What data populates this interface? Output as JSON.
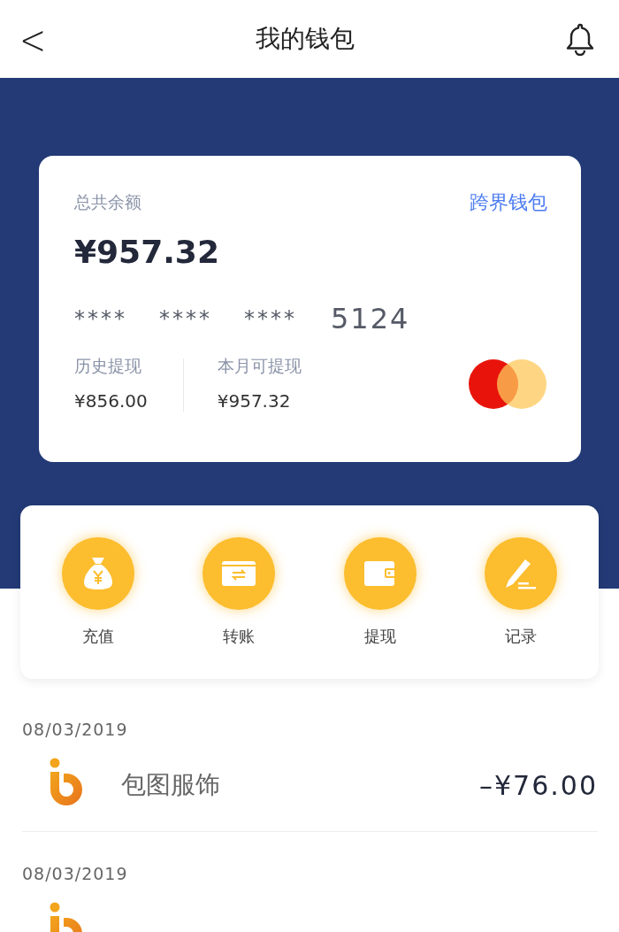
{
  "header": {
    "back": "<",
    "title": "我的钱包"
  },
  "card": {
    "balance_label": "总共余额",
    "link": "跨界钱包",
    "balance": "¥957.32",
    "masked": [
      "****",
      "****",
      "****"
    ],
    "last_digits": "5124",
    "stats": [
      {
        "label": "历史提现",
        "value": "¥856.00"
      },
      {
        "label": "本月可提现",
        "value": "¥957.32"
      }
    ]
  },
  "actions": [
    {
      "label": "充值"
    },
    {
      "label": "转账"
    },
    {
      "label": "提现"
    },
    {
      "label": "记录"
    }
  ],
  "transactions": [
    {
      "date": "08/03/2019",
      "merchant": "包图服饰",
      "amount": "–¥76.00"
    },
    {
      "date": "08/03/2019"
    }
  ]
}
